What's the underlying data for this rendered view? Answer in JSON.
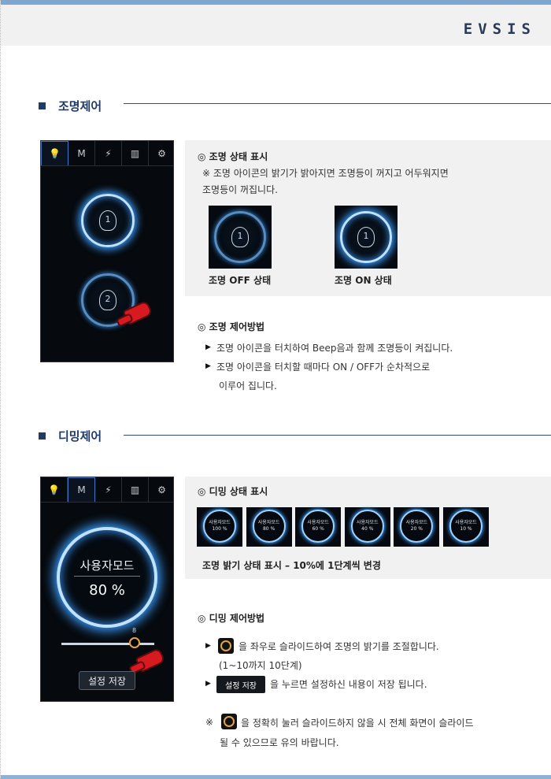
{
  "header": {
    "logo": "EVSIS"
  },
  "lighting": {
    "title": "조명제어",
    "phone": {
      "tabs": [
        "💡",
        "M",
        "⚡",
        "▥",
        "⚙"
      ],
      "light1": "1",
      "light2": "2"
    },
    "status": {
      "heading": "◎ 조명 상태 표시",
      "note1": "※ 조명 아이콘의 밝기가 밝아지면 조명등이 꺼지고 어두워지면",
      "note2": "조명등이 꺼집니다.",
      "off_label": "조명 OFF 상태",
      "on_label": "조명 ON 상태",
      "off_num": "1",
      "on_num": "1"
    },
    "method": {
      "heading": "◎ 조명 제어방법",
      "line1": "조명 아이콘을 터치하여 Beep음과 함께 조명등이 켜집니다.",
      "line2": "조명 아이콘을 터치할 때마다 ON / OFF가 순차적으로",
      "line3": "이루어  집니다."
    }
  },
  "dimming": {
    "title": "디밍제어",
    "phone": {
      "tabs": [
        "💡",
        "M",
        "⚡",
        "▥",
        "⚙"
      ],
      "mode": "사용자모드",
      "percent": "80  %",
      "slider_value": "8",
      "slider_level": 0.8,
      "save": "설정 저장"
    },
    "status": {
      "heading": "◎ 디밍 상태 표시",
      "thumbs": [
        {
          "mode": "사용자모드",
          "pct": "100 %"
        },
        {
          "mode": "사용자모드",
          "pct": "80 %"
        },
        {
          "mode": "사용자모드",
          "pct": "60 %"
        },
        {
          "mode": "사용자모드",
          "pct": "40 %"
        },
        {
          "mode": "사용자모드",
          "pct": "20 %"
        },
        {
          "mode": "사용자모드",
          "pct": "10 %"
        }
      ],
      "caption": "조명 밝기 상태 표시 – 10%에 1단계씩 변경"
    },
    "method": {
      "heading": "◎ 디밍 제어방법",
      "line1": "을 좌우로 슬라이드하여 조명의 밝기를 조절합니다.",
      "line2": "(1~10까지 10단계)",
      "save_chip": "설정 저장",
      "line3": "을 누르면 설정하신 내용이 저장 됩니다.",
      "note_mark": "※",
      "note1": "을 정확히 눌러 슬라이드하지 않을 시 전체 화면이 슬라이드",
      "note2": "될 수 있으므로 유의 바랍니다."
    }
  }
}
